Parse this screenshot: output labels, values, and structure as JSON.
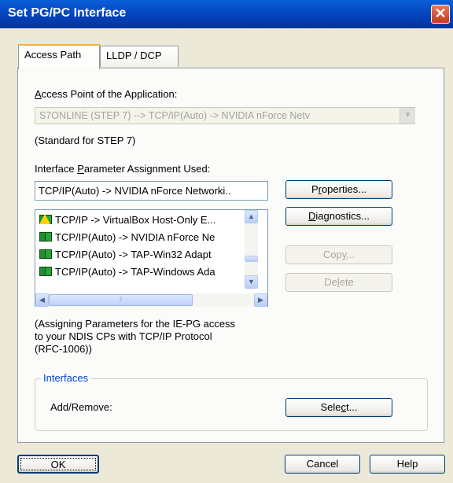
{
  "window": {
    "title": "Set PG/PC Interface",
    "close_label": "✕"
  },
  "tabs": [
    {
      "label": "Access Path",
      "active": true
    },
    {
      "label": "LLDP / DCP",
      "active": false
    }
  ],
  "access_point": {
    "label_pre": "",
    "label_accel": "A",
    "label_post": "ccess Point of the Application:",
    "value": "S7ONLINE      (STEP 7)      --> TCP/IP(Auto) -> NVIDIA nForce Netv",
    "note": "(Standard for STEP 7)"
  },
  "interface": {
    "label_pre": "Interface ",
    "label_accel": "P",
    "label_post": "arameter Assignment Used:",
    "value": "TCP/IP(Auto) -> NVIDIA nForce Networki..",
    "items": [
      {
        "text": "TCP/IP -> VirtualBox Host-Only E...",
        "icon": "warning-network-icon"
      },
      {
        "text": "TCP/IP(Auto) -> NVIDIA nForce Ne",
        "icon": "network-adapter-icon"
      },
      {
        "text": "TCP/IP(Auto) -> TAP-Win32 Adapt",
        "icon": "network-adapter-icon"
      },
      {
        "text": "TCP/IP(Auto) -> TAP-Windows Ada",
        "icon": "network-adapter-icon"
      }
    ],
    "description": [
      "(Assigning Parameters for the IE-PG access",
      "to your NDIS CPs with TCP/IP Protocol",
      "(RFC-1006))"
    ]
  },
  "buttons": {
    "properties": {
      "pre": "P",
      "accel": "r",
      "post": "operties..."
    },
    "diagnostics": {
      "pre": "",
      "accel": "D",
      "post": "iagnostics..."
    },
    "copy": {
      "pre": "Cop",
      "accel": "y",
      "post": "..."
    },
    "delete": {
      "pre": "De",
      "accel": "l",
      "post": "ete"
    }
  },
  "interfaces_group": {
    "title": "Interfaces",
    "add_remove_label": "Add/Remove:",
    "select": {
      "pre": "Sele",
      "accel": "c",
      "post": "t..."
    }
  },
  "footer": {
    "ok": "OK",
    "cancel": "Cancel",
    "help": "Help"
  }
}
